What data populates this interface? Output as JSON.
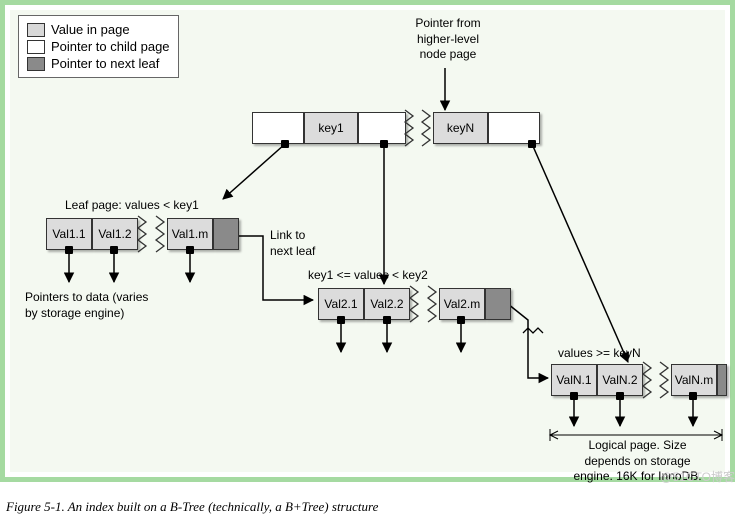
{
  "legend": {
    "value": "Value in page",
    "pointer": "Pointer to child page",
    "next": "Pointer to next leaf"
  },
  "labels": {
    "pointer_from": "Pointer from\nhigher-level\nnode page",
    "leaf_page": "Leaf page: values < key1",
    "link_next": "Link to\nnext leaf",
    "range2": "key1 <= values < key2",
    "rangeN": "values >= keyN",
    "pointers_data": "Pointers to data (varies\nby storage engine)",
    "logical_page": "Logical page. Size\ndepends on storage\nengine. 16K for InnoDB."
  },
  "root": {
    "key1": "key1",
    "keyN": "keyN"
  },
  "leaf1": {
    "v1": "Val1.1",
    "v2": "Val1.2",
    "vm": "Val1.m"
  },
  "leaf2": {
    "v1": "Val2.1",
    "v2": "Val2.2",
    "vm": "Val2.m"
  },
  "leafN": {
    "v1": "ValN.1",
    "v2": "ValN.2",
    "vm": "ValN.m"
  },
  "caption": "Figure 5-1. An index built on a B-Tree (technically, a B+Tree) structure",
  "watermark": "@51CTO博客"
}
